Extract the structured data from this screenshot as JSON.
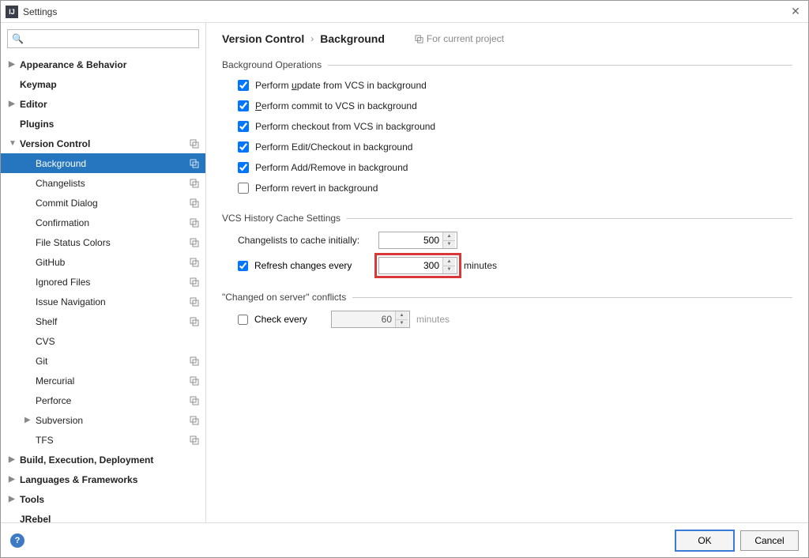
{
  "window": {
    "title": "Settings"
  },
  "search": {
    "placeholder": ""
  },
  "tree": {
    "items": [
      {
        "label": "Appearance & Behavior",
        "bold": true,
        "arrow": "right",
        "indent": 0
      },
      {
        "label": "Keymap",
        "bold": true,
        "arrow": "",
        "indent": 0
      },
      {
        "label": "Editor",
        "bold": true,
        "arrow": "right",
        "indent": 0
      },
      {
        "label": "Plugins",
        "bold": true,
        "arrow": "",
        "indent": 0
      },
      {
        "label": "Version Control",
        "bold": true,
        "arrow": "down",
        "indent": 0,
        "copy": true
      },
      {
        "label": "Background",
        "bold": false,
        "arrow": "",
        "indent": 1,
        "selected": true,
        "copy": true
      },
      {
        "label": "Changelists",
        "bold": false,
        "arrow": "",
        "indent": 1,
        "copy": true
      },
      {
        "label": "Commit Dialog",
        "bold": false,
        "arrow": "",
        "indent": 1,
        "copy": true
      },
      {
        "label": "Confirmation",
        "bold": false,
        "arrow": "",
        "indent": 1,
        "copy": true
      },
      {
        "label": "File Status Colors",
        "bold": false,
        "arrow": "",
        "indent": 1,
        "copy": true
      },
      {
        "label": "GitHub",
        "bold": false,
        "arrow": "",
        "indent": 1,
        "copy": true
      },
      {
        "label": "Ignored Files",
        "bold": false,
        "arrow": "",
        "indent": 1,
        "copy": true
      },
      {
        "label": "Issue Navigation",
        "bold": false,
        "arrow": "",
        "indent": 1,
        "copy": true
      },
      {
        "label": "Shelf",
        "bold": false,
        "arrow": "",
        "indent": 1,
        "copy": true
      },
      {
        "label": "CVS",
        "bold": false,
        "arrow": "",
        "indent": 1
      },
      {
        "label": "Git",
        "bold": false,
        "arrow": "",
        "indent": 1,
        "copy": true
      },
      {
        "label": "Mercurial",
        "bold": false,
        "arrow": "",
        "indent": 1,
        "copy": true
      },
      {
        "label": "Perforce",
        "bold": false,
        "arrow": "",
        "indent": 1,
        "copy": true
      },
      {
        "label": "Subversion",
        "bold": false,
        "arrow": "right",
        "indent": 1,
        "copy": true
      },
      {
        "label": "TFS",
        "bold": false,
        "arrow": "",
        "indent": 1,
        "copy": true
      },
      {
        "label": "Build, Execution, Deployment",
        "bold": true,
        "arrow": "right",
        "indent": 0
      },
      {
        "label": "Languages & Frameworks",
        "bold": true,
        "arrow": "right",
        "indent": 0
      },
      {
        "label": "Tools",
        "bold": true,
        "arrow": "right",
        "indent": 0
      },
      {
        "label": "JRebel",
        "bold": true,
        "arrow": "",
        "indent": 0
      }
    ]
  },
  "breadcrumb": {
    "parent": "Version Control",
    "current": "Background",
    "scope": "For current project"
  },
  "sections": {
    "bg_ops": {
      "title": "Background Operations",
      "checks": [
        {
          "label_pre": "Perform ",
          "underline": "u",
          "label_post": "pdate from VCS in background",
          "checked": true
        },
        {
          "label_pre": "",
          "underline": "P",
          "label_post": "erform commit to VCS in background",
          "checked": true
        },
        {
          "label_pre": "Perform checkout from VCS in background",
          "underline": "",
          "label_post": "",
          "checked": true
        },
        {
          "label_pre": "Perform Edit/Checkout in background",
          "underline": "",
          "label_post": "",
          "checked": true
        },
        {
          "label_pre": "Perform Add/Remove in background",
          "underline": "",
          "label_post": "",
          "checked": true
        },
        {
          "label_pre": "Perform revert in background",
          "underline": "",
          "label_post": "",
          "checked": false
        }
      ]
    },
    "cache": {
      "title": "VCS History Cache Settings",
      "row1": {
        "label": "Changelists to cache initially:",
        "value": "500"
      },
      "row2": {
        "label": "Refresh changes every",
        "checked": true,
        "value": "300",
        "suffix": "minutes"
      }
    },
    "conflicts": {
      "title": "\"Changed on server\" conflicts",
      "row": {
        "label": "Check every",
        "checked": false,
        "value": "60",
        "suffix": "minutes"
      }
    }
  },
  "footer": {
    "ok": "OK",
    "cancel": "Cancel"
  }
}
